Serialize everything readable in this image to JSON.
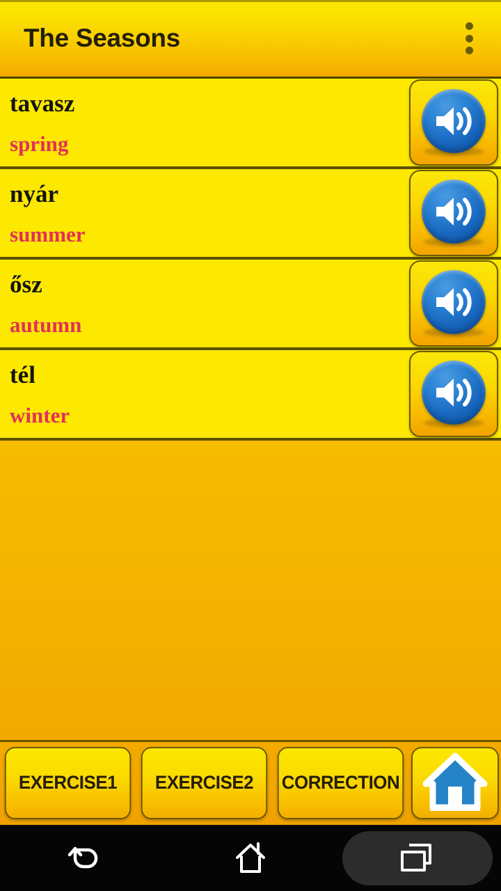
{
  "app": {
    "title": "The Seasons",
    "overflow_icon": "more-vert-icon",
    "accent_yellow": "#fde800",
    "accent_orange": "#f0a400",
    "native_text_color": "#141410",
    "translation_text_color": "#e33059",
    "divider_color": "#5c5006",
    "speaker_blue": "#1766bd"
  },
  "list": {
    "items": [
      {
        "native": "tavasz",
        "translation": "spring",
        "audio_icon": "speaker-icon"
      },
      {
        "native": "nyár",
        "translation": "summer",
        "audio_icon": "speaker-icon"
      },
      {
        "native": "ősz",
        "translation": "autumn",
        "audio_icon": "speaker-icon"
      },
      {
        "native": "tél",
        "translation": "winter",
        "audio_icon": "speaker-icon"
      }
    ]
  },
  "bottom_bar": {
    "buttons": [
      {
        "label": "EXERCISE1",
        "name": "exercise1-button"
      },
      {
        "label": "EXERCISE2",
        "name": "exercise2-button"
      },
      {
        "label": "CORRECTION",
        "name": "correction-button"
      }
    ],
    "home": {
      "icon": "home-house-icon",
      "label": ""
    }
  },
  "system_nav": {
    "back_icon": "back-arrow-icon",
    "home_icon": "home-outline-icon",
    "recents_icon": "recents-squares-icon",
    "recents_highlighted": true
  }
}
